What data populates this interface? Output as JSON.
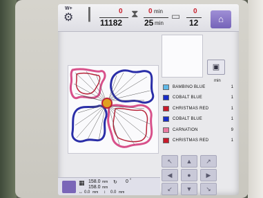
{
  "topbar": {
    "needle_label": "W+",
    "stitch_current": "0",
    "stitch_total": "11182",
    "time_current": "0",
    "time_unit_top": "min",
    "time_total": "25",
    "time_unit_bottom": "min",
    "color_current": "0",
    "color_total": "12",
    "home_icon": "house-icon"
  },
  "colors": {
    "min_header": "min",
    "items": [
      {
        "name": "BAMBINO BLUE",
        "color": "#5fb8e8",
        "min": "1"
      },
      {
        "name": "COBALT BLUE",
        "color": "#1a2ec8",
        "min": "1"
      },
      {
        "name": "CHRISTMAS RED",
        "color": "#c81a2a",
        "min": "1"
      },
      {
        "name": "COBALT BLUE",
        "color": "#1a2ec8",
        "min": "1"
      },
      {
        "name": "CARNATION",
        "color": "#e87aa0",
        "min": "9"
      },
      {
        "name": "CHRISTMAS RED",
        "color": "#c81a2a",
        "min": "1"
      }
    ]
  },
  "bottom": {
    "width_value": "158.0",
    "width_unit": "mm",
    "height_value": "158.0",
    "height_unit": "mm",
    "offset_x": "0.0",
    "offset_x_unit": "mm",
    "offset_y": "0.0",
    "offset_y_unit": "mm",
    "rotation": "0",
    "rotation_unit": "°"
  },
  "design": {
    "outline_blue": "#2a2ea8",
    "outline_pink": "#d8508a",
    "outline_red": "#b82238",
    "center": "#e0a020"
  }
}
